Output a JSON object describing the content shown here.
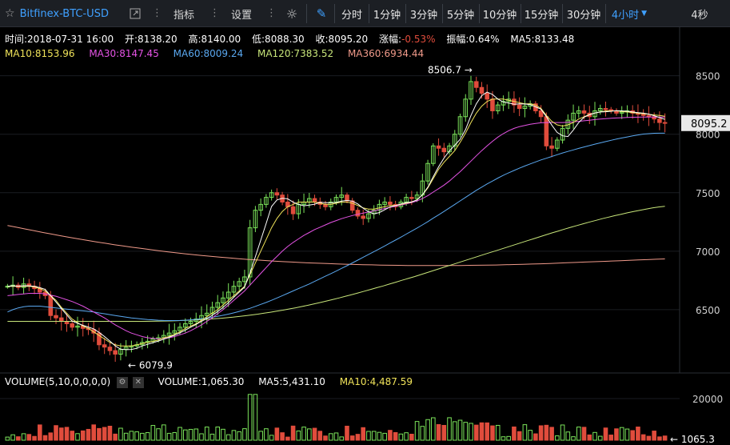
{
  "toolbar": {
    "symbol": "Bitfinex-BTC-USD",
    "indicators_label": "指标",
    "settings_label": "设置",
    "periods": [
      "分时",
      "1分钟",
      "3分钟",
      "5分钟",
      "10分钟",
      "15分钟",
      "30分钟",
      "4小时"
    ],
    "active_period": "4小时",
    "refresh": "4秒"
  },
  "info": {
    "time": "时间:2018-07-31 16:00",
    "open": "开:8138.20",
    "high": "高:8140.00",
    "low": "低:8088.30",
    "close": "收:8095.20",
    "change_label": "涨幅:",
    "change_value": "-0.53%",
    "amplitude": "振幅:0.64%",
    "ma5": "MA5:8133.48"
  },
  "ma_labels": {
    "ma10": "MA10:8153.96",
    "ma30": "MA30:8147.45",
    "ma60": "MA60:8009.24",
    "ma120": "MA120:7383.52",
    "ma360": "MA360:6934.44"
  },
  "colors": {
    "up": "#7be35a",
    "down": "#e04c3c",
    "ma5": "#ffffff",
    "ma10": "#f0e35a",
    "ma30": "#e553e5",
    "ma60": "#5aa8f0",
    "ma120": "#c8e67a",
    "ma360": "#f09a8a"
  },
  "volume": {
    "title": "VOLUME(5,10,0,0,0,0)",
    "value": "VOLUME:1,065.30",
    "ma5": "MA5:5,431.10",
    "ma10": "MA10:4,487.59"
  },
  "chart_data": {
    "type": "candlestick",
    "ylim": [
      6000,
      8600
    ],
    "y_ticks": [
      "8500",
      "8000",
      "7500",
      "7000",
      "6500"
    ],
    "current_price": "8095.2",
    "high_marker": "8506.7",
    "low_marker": "6079.9",
    "volume_ylim": [
      0,
      25000
    ],
    "volume_ticks": [
      "20000"
    ],
    "volume_marker": "1065.3",
    "candles_note": "approximate 4h candles read from chart",
    "close_path": [
      6700,
      6710,
      6690,
      6720,
      6700,
      6680,
      6650,
      6620,
      6450,
      6430,
      6400,
      6380,
      6350,
      6360,
      6340,
      6330,
      6300,
      6200,
      6180,
      6150,
      6120,
      6160,
      6180,
      6190,
      6200,
      6220,
      6230,
      6250,
      6260,
      6280,
      6300,
      6320,
      6350,
      6380,
      6400,
      6420,
      6450,
      6470,
      6520,
      6560,
      6600,
      6650,
      6700,
      6740,
      6780,
      7200,
      7350,
      7400,
      7460,
      7500,
      7480,
      7420,
      7380,
      7320,
      7400,
      7420,
      7450,
      7420,
      7400,
      7380,
      7420,
      7460,
      7480,
      7430,
      7350,
      7300,
      7280,
      7320,
      7350,
      7400,
      7420,
      7400,
      7380,
      7420,
      7460,
      7450,
      7480,
      7600,
      7750,
      7900,
      7880,
      7850,
      7900,
      8000,
      8150,
      8300,
      8450,
      8400,
      8350,
      8300,
      8200,
      8250,
      8280,
      8300,
      8250,
      8220,
      8240,
      8260,
      8200,
      8150,
      7900,
      7880,
      7950,
      8050,
      8120,
      8180,
      8200,
      8180,
      8150,
      8200,
      8220,
      8210,
      8200,
      8180,
      8190,
      8200,
      8180,
      8170,
      8160,
      8150,
      8130,
      8100,
      8095
    ],
    "ma10": [
      6700,
      6700,
      6700,
      6700,
      6700,
      6695,
      6680,
      6660,
      6620,
      6580,
      6520,
      6470,
      6420,
      6390,
      6360,
      6340,
      6310,
      6280,
      6250,
      6220,
      6200,
      6190,
      6190,
      6190,
      6200,
      6210,
      6220,
      6230,
      6240,
      6260,
      6270,
      6290,
      6310,
      6340,
      6360,
      6380,
      6410,
      6440,
      6470,
      6500,
      6540,
      6580,
      6620,
      6660,
      6700,
      6800,
      6900,
      7000,
      7100,
      7200,
      7280,
      7340,
      7380,
      7400,
      7420,
      7420,
      7420,
      7420,
      7410,
      7400,
      7400,
      7410,
      7420,
      7420,
      7410,
      7390,
      7370,
      7360,
      7360,
      7370,
      7380,
      7390,
      7390,
      7400,
      7410,
      7420,
      7440,
      7480,
      7540,
      7620,
      7700,
      7760,
      7810,
      7860,
      7930,
      8010,
      8100,
      8180,
      8240,
      8280,
      8300,
      8300,
      8300,
      8290,
      8280,
      8270,
      8260,
      8260,
      8250,
      8220,
      8160,
      8110,
      8080,
      8070,
      8080,
      8100,
      8130,
      8150,
      8170,
      8180,
      8190,
      8200,
      8200,
      8200,
      8195,
      8190,
      8185,
      8180,
      8175,
      8170,
      8165,
      8160,
      8154
    ],
    "ma30": [
      6620,
      6625,
      6630,
      6635,
      6640,
      6640,
      6640,
      6635,
      6625,
      6615,
      6600,
      6585,
      6570,
      6550,
      6530,
      6505,
      6480,
      6455,
      6430,
      6400,
      6370,
      6345,
      6320,
      6300,
      6285,
      6270,
      6260,
      6255,
      6250,
      6255,
      6260,
      6270,
      6285,
      6300,
      6320,
      6345,
      6370,
      6400,
      6430,
      6465,
      6500,
      6540,
      6580,
      6620,
      6660,
      6710,
      6760,
      6810,
      6860,
      6910,
      6955,
      7000,
      7040,
      7075,
      7105,
      7135,
      7160,
      7185,
      7205,
      7225,
      7245,
      7262,
      7278,
      7292,
      7305,
      7316,
      7326,
      7335,
      7345,
      7355,
      7365,
      7375,
      7385,
      7395,
      7405,
      7415,
      7430,
      7450,
      7475,
      7505,
      7535,
      7565,
      7600,
      7640,
      7680,
      7725,
      7770,
      7815,
      7860,
      7900,
      7940,
      7975,
      8005,
      8030,
      8050,
      8065,
      8075,
      8085,
      8092,
      8098,
      8100,
      8100,
      8100,
      8100,
      8102,
      8105,
      8110,
      8115,
      8120,
      8125,
      8130,
      8133,
      8136,
      8139,
      8141,
      8143,
      8145,
      8146,
      8147,
      8147,
      8147,
      8147,
      8147
    ],
    "ma60": [
      6480,
      6500,
      6515,
      6525,
      6530,
      6530,
      6530,
      6525,
      6520,
      6515,
      6510,
      6505,
      6500,
      6495,
      6490,
      6485,
      6480,
      6472,
      6465,
      6458,
      6450,
      6443,
      6436,
      6430,
      6425,
      6420,
      6416,
      6413,
      6410,
      6408,
      6407,
      6407,
      6408,
      6410,
      6413,
      6417,
      6422,
      6428,
      6435,
      6443,
      6452,
      6462,
      6473,
      6485,
      6498,
      6512,
      6528,
      6545,
      6562,
      6580,
      6600,
      6620,
      6640,
      6660,
      6680,
      6700,
      6720,
      6742,
      6764,
      6786,
      6808,
      6830,
      6853,
      6876,
      6900,
      6924,
      6948,
      6972,
      6996,
      7020,
      7045,
      7070,
      7095,
      7120,
      7146,
      7172,
      7198,
      7225,
      7253,
      7282,
      7311,
      7340,
      7370,
      7400,
      7430,
      7460,
      7490,
      7520,
      7548,
      7575,
      7600,
      7625,
      7648,
      7670,
      7690,
      7710,
      7728,
      7746,
      7763,
      7780,
      7795,
      7810,
      7825,
      7840,
      7853,
      7866,
      7879,
      7891,
      7903,
      7915,
      7926,
      7937,
      7948,
      7958,
      7968,
      7977,
      7986,
      7994,
      8001,
      8005,
      8008,
      8009,
      8009
    ],
    "ma120": [
      6400,
      6400,
      6400,
      6400,
      6400,
      6400,
      6400,
      6400,
      6400,
      6400,
      6400,
      6400,
      6400,
      6400,
      6400,
      6400,
      6400,
      6400,
      6400,
      6400,
      6400,
      6400,
      6400,
      6401,
      6402,
      6403,
      6404,
      6406,
      6408,
      6410,
      6412,
      6415,
      6418,
      6422,
      6426,
      6431,
      6436,
      6442,
      6448,
      6455,
      6462,
      6470,
      6478,
      6487,
      6496,
      6506,
      6516,
      6527,
      6538,
      6550,
      6562,
      6575,
      6588,
      6601,
      6615,
      6629,
      6643,
      6658,
      6673,
      6688,
      6703,
      6719,
      6735,
      6751,
      6767,
      6783,
      6800,
      6817,
      6834,
      6851,
      6868,
      6885,
      6902,
      6919,
      6936,
      6953,
      6970,
      6987,
      7004,
      7021,
      7038,
      7055,
      7072,
      7089,
      7106,
      7123,
      7140,
      7157,
      7173,
      7189,
      7205,
      7220,
      7235,
      7250,
      7264,
      7278,
      7291,
      7304,
      7316,
      7328,
      7339,
      7350,
      7360,
      7370,
      7378,
      7384
    ],
    "ma360": [
      7220,
      7205,
      7190,
      7175,
      7160,
      7146,
      7132,
      7118,
      7105,
      7092,
      7080,
      7068,
      7056,
      7045,
      7034,
      7024,
      7014,
      7004,
      6995,
      6986,
      6978,
      6970,
      6962,
      6955,
      6948,
      6942,
      6936,
      6930,
      6925,
      6920,
      6915,
      6911,
      6907,
      6903,
      6900,
      6897,
      6894,
      6891,
      6889,
      6887,
      6885,
      6883,
      6881,
      6880,
      6879,
      6878,
      6877,
      6877,
      6877,
      6877,
      6877,
      6878,
      6879,
      6880,
      6881,
      6882,
      6884,
      6886,
      6888,
      6890,
      6892,
      6895,
      6898,
      6901,
      6904,
      6907,
      6910,
      6913,
      6916,
      6919,
      6922,
      6925,
      6928,
      6931,
      6934
    ]
  }
}
